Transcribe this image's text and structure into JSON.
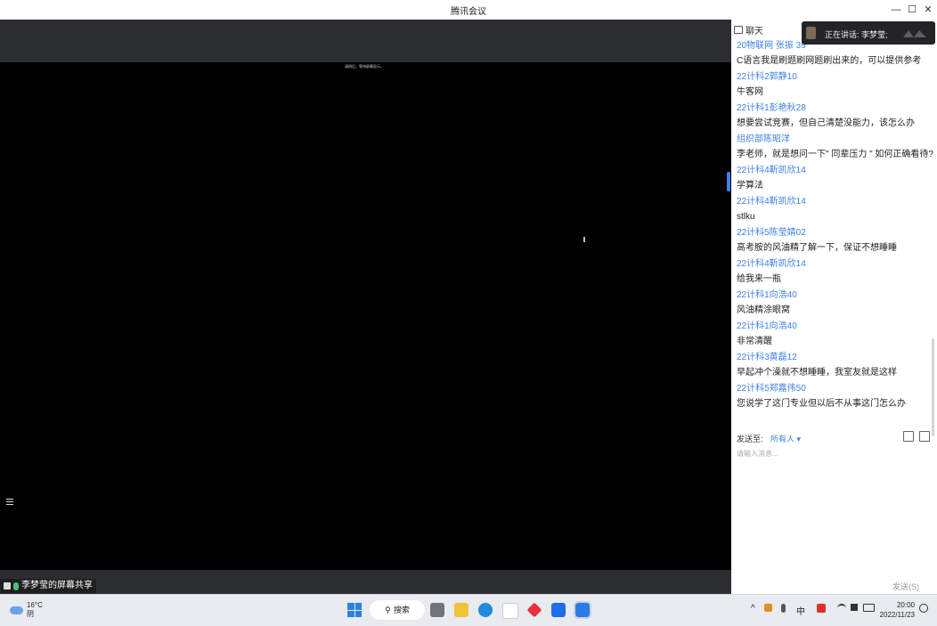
{
  "window": {
    "title": "腾讯会议",
    "minimize": "—",
    "maximize": "☐",
    "close": "✕"
  },
  "stage": {
    "shared_caption": "请稍后，等待屏幕显示。",
    "share_label": "李梦莹的屏幕共享"
  },
  "speaking": {
    "text": "正在讲话: 李梦莹;"
  },
  "chat": {
    "header": "聊天",
    "messages": [
      {
        "name": "20物联网 张振 39",
        "text": "C语言我是刷题刷网题刷出来的，可以提供参考"
      },
      {
        "name": "22计科2郭静10",
        "text": "牛客网"
      },
      {
        "name": "22计科1彭艳秋28",
        "text": "想要尝试竞赛，但自己清楚没能力，该怎么办"
      },
      {
        "name": "组织部陈昭洋",
        "text": "李老师，就是想问一下\" 同辈压力 \" 如何正确看待?"
      },
      {
        "name": "22计科4靳凯欣14",
        "text": "学算法"
      },
      {
        "name": "22计科4靳凯欣14",
        "text": "stlku"
      },
      {
        "name": "22计科5陈莹婧02",
        "text": "高考胺的风油精了解一下，保证不想睡睡"
      },
      {
        "name": "22计科4靳凯欣14",
        "text": "给我来一瓶"
      },
      {
        "name": "22计科1向浩40",
        "text": "风油精涂眼窝"
      },
      {
        "name": "22计科1向浩40",
        "text": "非常清醒"
      },
      {
        "name": "22计科3黄磊12",
        "text": "早起冲个澡就不想睡睡，我室友就是这样"
      },
      {
        "name": "22计科5郑嘉伟50",
        "text": "您说学了这门专业但以后不从事这门怎么办"
      }
    ],
    "send_to_label": "发送至:",
    "send_to_value": "所有人 ▾",
    "input_placeholder": "请输入消息...",
    "send_button": "发送(S)"
  },
  "taskbar": {
    "weather_temp": "16°C",
    "weather_desc": "阴",
    "search_label": "搜索",
    "search_glyph": "⚲",
    "tray_chevron": "^",
    "ime": "中",
    "time": "20:00",
    "date": "2022/11/23"
  },
  "colors": {
    "accent": "#3e82e6",
    "stage_bg": "#2b2d31",
    "taskbar_bg": "#e8ebf0"
  }
}
